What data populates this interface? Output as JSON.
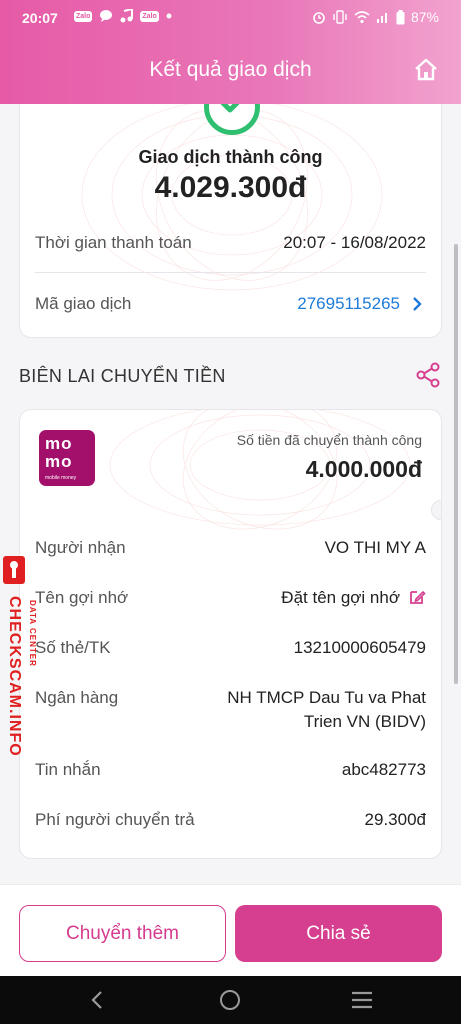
{
  "status_bar": {
    "time": "20:07",
    "zalo_badge": "Zalo",
    "battery": "87%"
  },
  "header": {
    "title": "Kết quả giao dịch"
  },
  "result_card": {
    "status_text": "Giao dịch thành công",
    "amount": "4.029.300đ",
    "rows": [
      {
        "label": "Thời gian thanh toán",
        "value": "20:07 - 16/08/2022"
      },
      {
        "label": "Mã giao dịch",
        "value": "27695115265"
      }
    ]
  },
  "receipt": {
    "section_title": "BIÊN LAI CHUYỂN TIỀN",
    "logo": {
      "line1": "mo",
      "line2": "mo",
      "line3": "mobile money"
    },
    "sent_label": "Số tiền đã chuyển thành công",
    "sent_amount": "4.000.000đ",
    "rows": [
      {
        "label": "Người nhận",
        "value": "VO THI MY A"
      },
      {
        "label": "Tên gợi nhớ",
        "value": "Đặt tên gợi nhớ"
      },
      {
        "label": "Số thẻ/TK",
        "value": "13210000605479"
      },
      {
        "label": "Ngân hàng",
        "value_line1": "NH TMCP Dau Tu va Phat",
        "value_line2": "Trien VN (BIDV)"
      },
      {
        "label": "Tin nhắn",
        "value": "abc482773"
      },
      {
        "label": "Phí người chuyển trả",
        "value": "29.300đ"
      }
    ]
  },
  "watermark": {
    "text": "CHECKSCAM.INFO",
    "sub": "DATA CENTER"
  },
  "actions": {
    "transfer_more": "Chuyển thêm",
    "share": "Chia sẻ"
  },
  "colors": {
    "brand_pink": "#d63f8f",
    "momo_purple": "#a3106c",
    "success_green": "#2fbf71",
    "link_blue": "#1e7bd9"
  }
}
